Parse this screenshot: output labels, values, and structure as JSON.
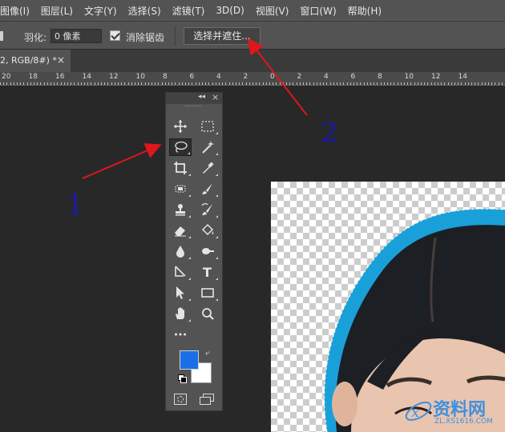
{
  "menubar": {
    "items": [
      "图像(I)",
      "图层(L)",
      "文字(Y)",
      "选择(S)",
      "滤镜(T)",
      "3D(D)",
      "视图(V)",
      "窗口(W)",
      "帮助(H)"
    ]
  },
  "options": {
    "feather_label": "羽化:",
    "feather_value": "0 像素",
    "antialias_label": "消除锯齿",
    "antialias_checked": true,
    "select_mask_button": "选择并遮住..."
  },
  "document": {
    "tab_title": "2, RGB/8#) *",
    "tab_close": "×"
  },
  "ruler": {
    "labels": [
      "20",
      "18",
      "16",
      "14",
      "12",
      "10",
      "8",
      "6",
      "4",
      "2",
      "0",
      "2",
      "4",
      "6",
      "8",
      "10",
      "12",
      "14"
    ]
  },
  "toolbox": {
    "header_collapse": "◂◂",
    "header_close": "×",
    "foreground_color": "#1a6fe6",
    "background_color": "#ffffff",
    "tools": [
      {
        "name": "move-tool",
        "icon": "move-icon"
      },
      {
        "name": "marquee-tool",
        "icon": "rect-marquee-icon"
      },
      {
        "name": "lasso-tool",
        "icon": "lasso-icon",
        "active": true
      },
      {
        "name": "magic-wand-tool",
        "icon": "magic-wand-icon"
      },
      {
        "name": "crop-tool",
        "icon": "crop-icon"
      },
      {
        "name": "eyedropper-tool",
        "icon": "eyedropper-icon"
      },
      {
        "name": "healing-tool",
        "icon": "healing-icon"
      },
      {
        "name": "brush-tool",
        "icon": "brush-icon"
      },
      {
        "name": "stamp-tool",
        "icon": "stamp-icon"
      },
      {
        "name": "history-brush-tool",
        "icon": "history-brush-icon"
      },
      {
        "name": "eraser-tool",
        "icon": "eraser-icon"
      },
      {
        "name": "paint-bucket-tool",
        "icon": "paint-bucket-icon"
      },
      {
        "name": "blur-tool",
        "icon": "blur-drop-icon"
      },
      {
        "name": "dodge-tool",
        "icon": "dodge-icon"
      },
      {
        "name": "pen-tool",
        "icon": "pen-icon"
      },
      {
        "name": "type-tool",
        "icon": "type-icon"
      },
      {
        "name": "path-select-tool",
        "icon": "arrow-icon"
      },
      {
        "name": "shape-tool",
        "icon": "rectangle-icon"
      },
      {
        "name": "hand-tool",
        "icon": "hand-icon"
      },
      {
        "name": "zoom-tool",
        "icon": "zoom-icon"
      },
      {
        "name": "more-tools",
        "icon": "ellipsis-icon"
      }
    ],
    "type_glyph": "T",
    "more_glyph": "•••"
  },
  "annotations": {
    "label1": "1",
    "label2": "2",
    "arrow_color": "#e0161b"
  },
  "watermark": {
    "text": "资料网",
    "url": "ZL.XS1616.COM"
  }
}
